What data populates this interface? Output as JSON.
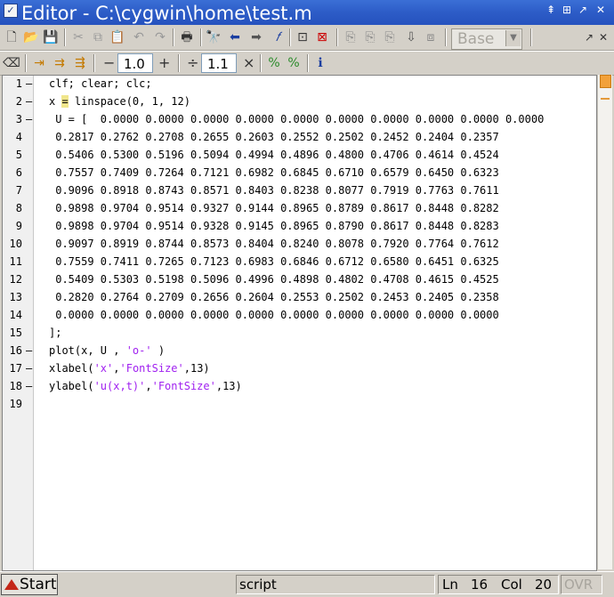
{
  "window": {
    "title": "Editor - C:\\cygwin\\home\\test.m",
    "controls": [
      "⇞",
      "⊞",
      "↗",
      "✕"
    ]
  },
  "toolbar": {
    "cell_mode_combo_value": "Base",
    "dock_arrow": "▾"
  },
  "cell_toolbar": {
    "minus_label": "−",
    "plus_label": "+",
    "value1": "1.0",
    "divide_label": "÷",
    "value2": "1.1",
    "times_label": "×"
  },
  "editor": {
    "lines": [
      {
        "num": "1",
        "bp": "–",
        "text": "clf; clear; clc;"
      },
      {
        "num": "2",
        "bp": "–",
        "pre": "x ",
        "eq": "=",
        "post": " linspace(0, 1, 12)"
      },
      {
        "num": "3",
        "bp": "–",
        "text": " U = [  0.0000 0.0000 0.0000 0.0000 0.0000 0.0000 0.0000 0.0000 0.0000 0.0000"
      },
      {
        "num": "4",
        "bp": "",
        "text": " 0.2817 0.2762 0.2708 0.2655 0.2603 0.2552 0.2502 0.2452 0.2404 0.2357"
      },
      {
        "num": "5",
        "bp": "",
        "text": " 0.5406 0.5300 0.5196 0.5094 0.4994 0.4896 0.4800 0.4706 0.4614 0.4524"
      },
      {
        "num": "6",
        "bp": "",
        "text": " 0.7557 0.7409 0.7264 0.7121 0.6982 0.6845 0.6710 0.6579 0.6450 0.6323"
      },
      {
        "num": "7",
        "bp": "",
        "text": " 0.9096 0.8918 0.8743 0.8571 0.8403 0.8238 0.8077 0.7919 0.7763 0.7611"
      },
      {
        "num": "8",
        "bp": "",
        "text": " 0.9898 0.9704 0.9514 0.9327 0.9144 0.8965 0.8789 0.8617 0.8448 0.8282"
      },
      {
        "num": "9",
        "bp": "",
        "text": " 0.9898 0.9704 0.9514 0.9328 0.9145 0.8965 0.8790 0.8617 0.8448 0.8283"
      },
      {
        "num": "10",
        "bp": "",
        "text": " 0.9097 0.8919 0.8744 0.8573 0.8404 0.8240 0.8078 0.7920 0.7764 0.7612"
      },
      {
        "num": "11",
        "bp": "",
        "text": " 0.7559 0.7411 0.7265 0.7123 0.6983 0.6846 0.6712 0.6580 0.6451 0.6325"
      },
      {
        "num": "12",
        "bp": "",
        "text": " 0.5409 0.5303 0.5198 0.5096 0.4996 0.4898 0.4802 0.4708 0.4615 0.4525"
      },
      {
        "num": "13",
        "bp": "",
        "text": " 0.2820 0.2764 0.2709 0.2656 0.2604 0.2553 0.2502 0.2453 0.2405 0.2358"
      },
      {
        "num": "14",
        "bp": "",
        "text": " 0.0000 0.0000 0.0000 0.0000 0.0000 0.0000 0.0000 0.0000 0.0000 0.0000"
      },
      {
        "num": "15",
        "bp": "",
        "text": "];"
      },
      {
        "num": "16",
        "bp": "–",
        "pre": "plot(x, U , ",
        "str": "'o-'",
        "post": " )"
      },
      {
        "num": "17",
        "bp": "–",
        "pre": "xlabel(",
        "str": "'x'",
        "mid": ",",
        "str2": "'FontSize'",
        "post": ",13)"
      },
      {
        "num": "18",
        "bp": "–",
        "pre": "ylabel(",
        "str": "'u(x,t)'",
        "mid": ",",
        "str2": "'FontSize'",
        "post": ",13)"
      },
      {
        "num": "19",
        "bp": "",
        "text": ""
      }
    ]
  },
  "statusbar": {
    "start_label": "Start",
    "mode": "script",
    "ln_label": "Ln",
    "ln_value": "16",
    "col_label": "Col",
    "col_value": "20",
    "ovr_label": "OVR"
  }
}
